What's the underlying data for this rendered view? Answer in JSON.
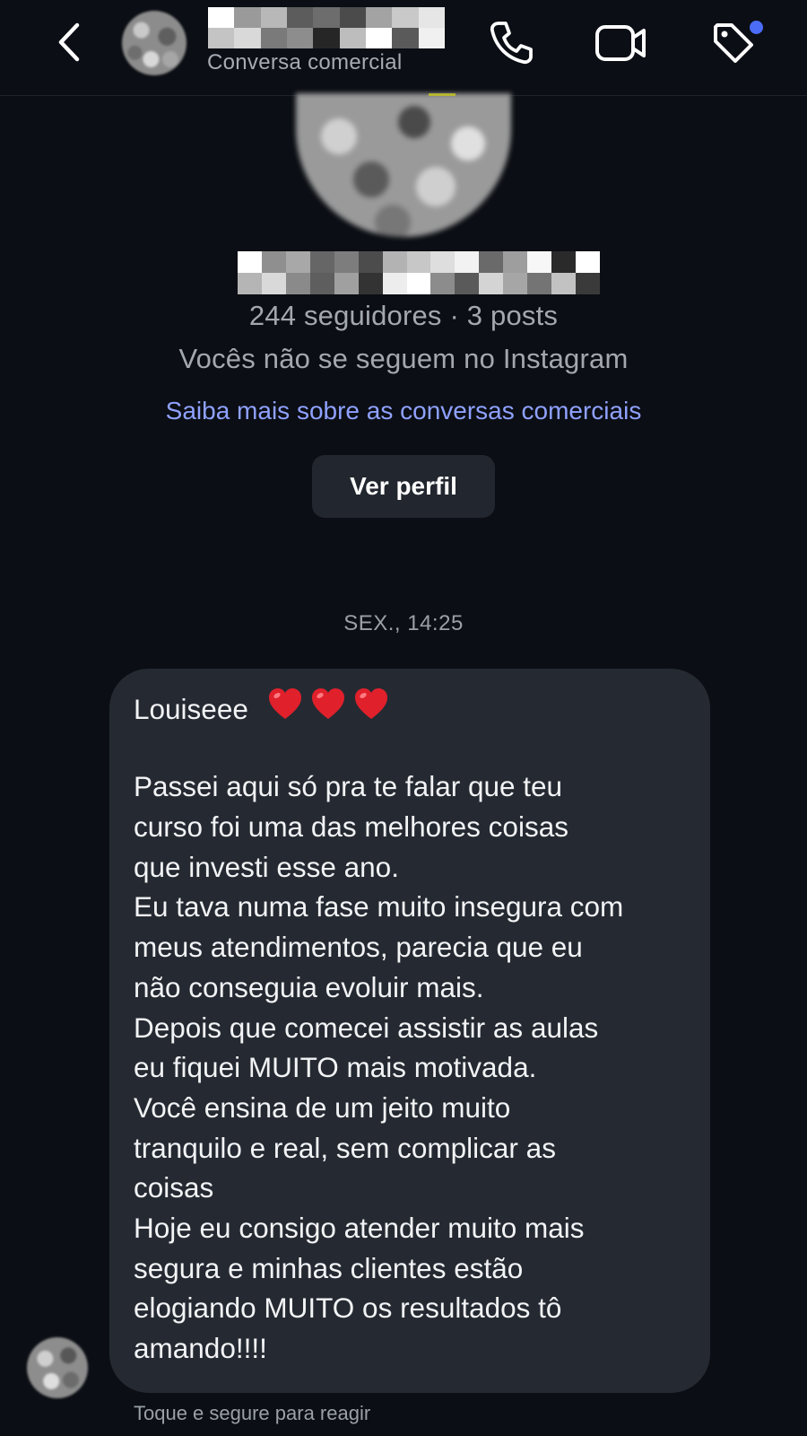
{
  "header": {
    "subtitle": "Conversa comercial",
    "back_icon": "chevron-left-icon",
    "phone_icon": "phone-icon",
    "video_icon": "video-camera-icon",
    "tag_icon": "tag-icon",
    "notification_dot_color": "#4a6cf7"
  },
  "profile": {
    "stats": "244 seguidores · 3 posts",
    "follow_status": "Vocês não se seguem no Instagram",
    "learn_more_link": "Saiba mais sobre as conversas comerciais",
    "view_profile_button": "Ver perfil",
    "link_color": "#8fa1ff"
  },
  "thread": {
    "timestamp": "SEX., 14:25",
    "message": {
      "lines": [
        "Louiseee",
        "",
        "Passei aqui só pra te falar que teu",
        "curso foi uma das melhores coisas",
        "que investi esse ano.",
        "Eu tava numa fase muito insegura com",
        "meus atendimentos, parecia que eu",
        "não conseguia evoluir mais.",
        "Depois que comecei assistir as aulas",
        "eu fiquei MUITO mais motivada.",
        "Você ensina de um jeito muito",
        "tranquilo e real, sem complicar as",
        "coisas",
        "Hoje eu consigo atender muito mais",
        "segura e minhas clientes estão",
        "elogiando MUITO os resultados tô",
        "amando!!!!"
      ],
      "emoji": [
        "red-heart-icon",
        "red-heart-icon",
        "red-heart-icon"
      ],
      "bubble_color": "#252a32"
    },
    "react_hint": "Toque e segure para reagir"
  }
}
